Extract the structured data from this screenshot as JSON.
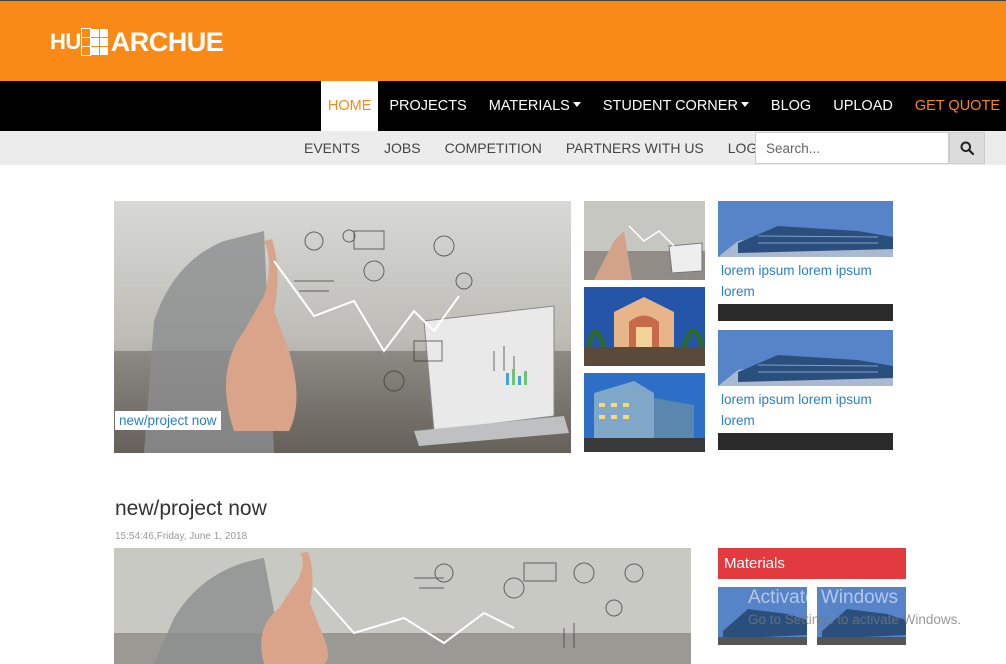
{
  "brand": {
    "logo_left": "HU",
    "logo_right": "ARCHUE",
    "orange": "#fa8a17",
    "red": "#e23a3f",
    "link": "#2a7fc9"
  },
  "main_nav": [
    {
      "label": "HOME",
      "active": true
    },
    {
      "label": "PROJECTS"
    },
    {
      "label": "MATERIALS",
      "dropdown": true
    },
    {
      "label": "STUDENT CORNER",
      "dropdown": true
    },
    {
      "label": "BLOG"
    },
    {
      "label": "UPLOAD"
    },
    {
      "label": "GET QUOTE",
      "highlight": true
    }
  ],
  "sub_nav": [
    "EVENTS",
    "JOBS",
    "COMPETITION",
    "PARTNERS WITH US",
    "LOGIN"
  ],
  "search": {
    "placeholder": "Search...",
    "icon": "search-icon"
  },
  "hero": {
    "caption": "new/project now"
  },
  "side_cards": [
    {
      "text": "lorem ipsum lorem ipsum lorem"
    },
    {
      "text": "lorem ipsum lorem ipsum lorem"
    }
  ],
  "post": {
    "title": "new/project now",
    "date": "15:54:46,Friday, June 1, 2018"
  },
  "sidebar": {
    "materials_title": "Materials"
  },
  "watermark": {
    "line1": "Activate Windows",
    "line2": "Go to Settings to activate Windows."
  }
}
